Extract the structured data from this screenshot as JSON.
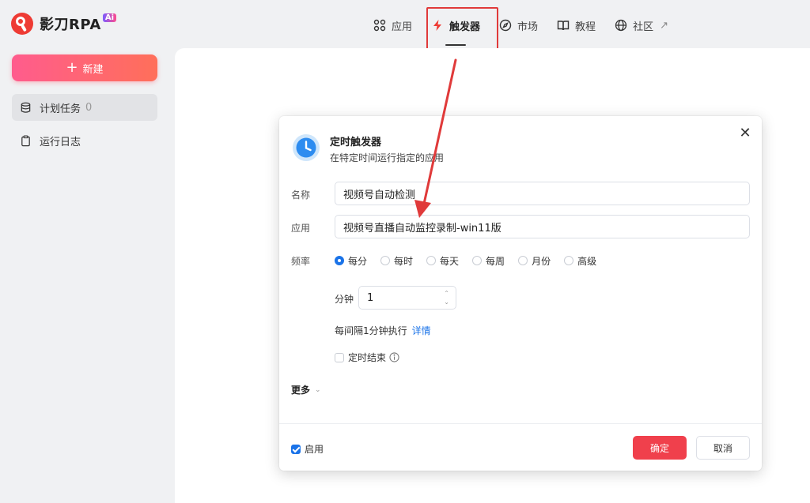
{
  "app": {
    "logo_text": "影刀RPA",
    "logo_badge": "Ai"
  },
  "nav": {
    "items": [
      {
        "label": "应用",
        "icon": "apps-grid-icon"
      },
      {
        "label": "触发器",
        "icon": "lightning-icon"
      },
      {
        "label": "市场",
        "icon": "compass-icon"
      },
      {
        "label": "教程",
        "icon": "book-icon"
      },
      {
        "label": "社区",
        "icon": "globe-icon"
      }
    ],
    "active": "触发器",
    "external_arrow": "↗"
  },
  "sidebar": {
    "new_button": "新建",
    "items": [
      {
        "label": "计划任务",
        "count": "0",
        "icon": "database-icon"
      },
      {
        "label": "运行日志",
        "icon": "clipboard-icon"
      }
    ]
  },
  "dialog": {
    "title": "定时触发器",
    "subtitle": "在特定时间运行指定的应用",
    "close": "✕",
    "name_label": "名称",
    "name_value": "视频号自动检测",
    "app_label": "应用",
    "app_value": "视频号直播自动监控录制-win11版",
    "freq_label": "频率",
    "freq_options": [
      "每分",
      "每时",
      "每天",
      "每周",
      "月份",
      "高级"
    ],
    "freq_selected": "每分",
    "minute_label": "分钟",
    "minute_value": "1",
    "interval_text": "每间隔1分钟执行",
    "detail_link": "详情",
    "end_timer_label": "定时结束",
    "more_label": "更多",
    "enable_label": "启用",
    "enabled": true,
    "ok_button": "确定",
    "cancel_button": "取消"
  },
  "colors": {
    "accent_blue": "#1a73e8",
    "confirm_red": "#f0404c",
    "annotation_red": "#e03a3a",
    "new_button_gradient_start": "#ff5c8d",
    "new_button_gradient_end": "#ff6f5a"
  }
}
